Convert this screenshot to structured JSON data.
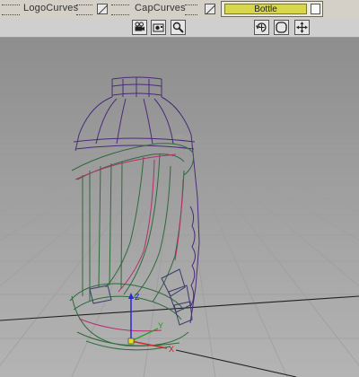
{
  "layers": {
    "logo_curves": "LogoCurves",
    "cap_curves": "CapCurves",
    "bottle": "Bottle"
  },
  "toolbar": {
    "left_tools": [
      "camera-icon",
      "film-camera-icon",
      "zoom-icon"
    ],
    "right_tools": [
      "rotate-view-icon",
      "frame-view-icon",
      "move-view-icon"
    ]
  },
  "viewport": {
    "background_top": "#8e8e8e",
    "background_bottom": "#b4b4b4",
    "grid_color": "#9c9c9c",
    "wire_colors": {
      "bottle": "#5a2f8a",
      "handle": "#2d6b3c",
      "highlight": "#c03070"
    },
    "axis_gizmo": [
      "X",
      "Y",
      "Z"
    ]
  }
}
